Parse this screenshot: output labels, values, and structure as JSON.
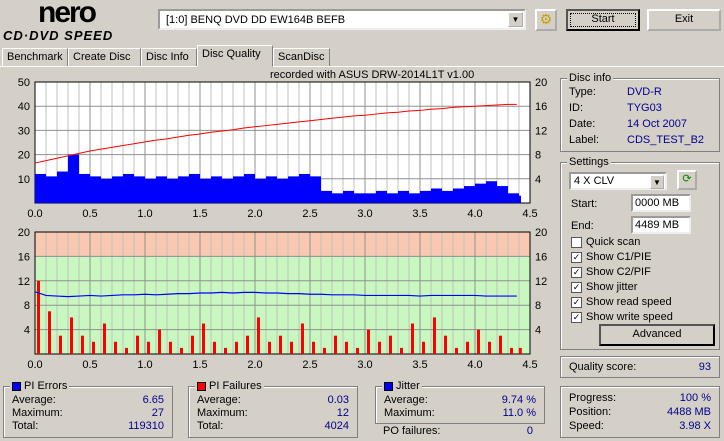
{
  "logo": {
    "top": "nero",
    "bottom": "CD·DVD SPEED"
  },
  "drive": "[1:0]  BENQ DVD DD EW164B BEFB",
  "buttons": {
    "start": "Start",
    "exit": "Exit",
    "advanced": "Advanced"
  },
  "tabs": [
    "Benchmark",
    "Create Disc",
    "Disc Info",
    "Disc Quality",
    "ScanDisc"
  ],
  "active_tab": "Disc Quality",
  "recorded_with": "recorded with ASUS    DRW-2014L1T      v1.00",
  "disc_info": {
    "title": "Disc info",
    "type_label": "Type:",
    "type": "DVD-R",
    "id_label": "ID:",
    "id": "TYG03",
    "date_label": "Date:",
    "date": "14 Oct 2007",
    "label_label": "Label:",
    "label": "CDS_TEST_B2"
  },
  "settings": {
    "title": "Settings",
    "speed": "4 X CLV",
    "start_label": "Start:",
    "start": "0000 MB",
    "end_label": "End:",
    "end": "4489 MB",
    "checks": [
      {
        "label": "Quick scan",
        "checked": false
      },
      {
        "label": "Show C1/PIE",
        "checked": true
      },
      {
        "label": "Show C2/PIF",
        "checked": true
      },
      {
        "label": "Show jitter",
        "checked": true
      },
      {
        "label": "Show read speed",
        "checked": true
      },
      {
        "label": "Show write speed",
        "checked": true
      }
    ]
  },
  "quality": {
    "label": "Quality score:",
    "value": "93"
  },
  "progress": {
    "progress_label": "Progress:",
    "progress": "100 %",
    "position_label": "Position:",
    "position": "4488 MB",
    "speed_label": "Speed:",
    "speed": "3.98 X"
  },
  "pi_errors": {
    "title": "PI Errors",
    "average_label": "Average:",
    "average": "6.65",
    "maximum_label": "Maximum:",
    "maximum": "27",
    "total_label": "Total:",
    "total": "119310"
  },
  "pi_failures": {
    "title": "PI Failures",
    "average_label": "Average:",
    "average": "0.03",
    "maximum_label": "Maximum:",
    "maximum": "12",
    "total_label": "Total:",
    "total": "4024"
  },
  "jitter": {
    "title": "Jitter",
    "average_label": "Average:",
    "average": "9.74 %",
    "maximum_label": "Maximum:",
    "maximum": "11.0 %",
    "po_label": "PO failures:",
    "po": "0"
  },
  "colors": {
    "pie": "#0000ff",
    "pif": "#ff0000",
    "jitter": "#0000ff",
    "speed": "#ff0000"
  },
  "chart_data": [
    {
      "type": "bar",
      "title": "PI errors / read speed",
      "x_ticks": [
        "0.0",
        "0.5",
        "1.0",
        "1.5",
        "2.0",
        "2.5",
        "3.0",
        "3.5",
        "4.0",
        "4.5"
      ],
      "xlim": [
        0,
        4.5
      ],
      "ylim": [
        0,
        50
      ],
      "y_ticks": [
        "10",
        "20",
        "30",
        "40",
        "50"
      ],
      "y2lim": [
        0,
        20
      ],
      "y2_ticks": [
        "4",
        "8",
        "12",
        "16",
        "20"
      ],
      "x": [
        0.0,
        0.1,
        0.2,
        0.3,
        0.4,
        0.5,
        0.6,
        0.7,
        0.8,
        0.9,
        1.0,
        1.1,
        1.2,
        1.3,
        1.4,
        1.5,
        1.6,
        1.7,
        1.8,
        1.9,
        2.0,
        2.1,
        2.2,
        2.3,
        2.4,
        2.5,
        2.6,
        2.7,
        2.8,
        2.9,
        3.0,
        3.1,
        3.2,
        3.3,
        3.4,
        3.5,
        3.6,
        3.7,
        3.8,
        3.9,
        4.0,
        4.1,
        4.2,
        4.3,
        4.38
      ],
      "pi_errors": [
        12,
        11,
        13,
        20,
        12,
        11,
        10,
        11,
        12,
        11,
        10,
        11,
        10,
        11,
        12,
        10,
        11,
        10,
        11,
        12,
        10,
        11,
        10,
        11,
        12,
        11,
        5,
        4,
        5,
        4,
        4,
        5,
        4,
        5,
        4,
        5,
        6,
        5,
        6,
        7,
        8,
        9,
        7,
        4,
        3
      ],
      "read_speed": [
        6.6,
        7.0,
        7.4,
        7.8,
        8.2,
        8.6,
        8.9,
        9.2,
        9.5,
        9.8,
        10.1,
        10.4,
        10.6,
        10.9,
        11.2,
        11.4,
        11.7,
        11.9,
        12.1,
        12.4,
        12.6,
        12.8,
        13.0,
        13.2,
        13.4,
        13.6,
        13.8,
        14.0,
        14.2,
        14.4,
        14.5,
        14.7,
        14.9,
        15.0,
        15.2,
        15.3,
        15.5,
        15.6,
        15.8,
        15.9,
        16.0,
        16.1,
        16.2,
        16.3,
        16.3
      ]
    },
    {
      "type": "bar",
      "title": "PI failures / jitter",
      "x_ticks": [
        "0.0",
        "0.5",
        "1.0",
        "1.5",
        "2.0",
        "2.5",
        "3.0",
        "3.5",
        "4.0",
        "4.5"
      ],
      "xlim": [
        0,
        4.5
      ],
      "ylim": [
        0,
        20
      ],
      "y_ticks": [
        "4",
        "8",
        "12",
        "16",
        "20"
      ],
      "y2_ticks": [
        "4",
        "8",
        "12",
        "16",
        "20"
      ],
      "x": [
        0.0,
        0.1,
        0.2,
        0.3,
        0.4,
        0.5,
        0.6,
        0.7,
        0.8,
        0.9,
        1.0,
        1.1,
        1.2,
        1.3,
        1.4,
        1.5,
        1.6,
        1.7,
        1.8,
        1.9,
        2.0,
        2.1,
        2.2,
        2.3,
        2.4,
        2.5,
        2.6,
        2.7,
        2.8,
        2.9,
        3.0,
        3.1,
        3.2,
        3.3,
        3.4,
        3.5,
        3.6,
        3.7,
        3.8,
        3.9,
        4.0,
        4.1,
        4.2,
        4.3,
        4.38
      ],
      "pi_failures": [
        12,
        7,
        3,
        6,
        3,
        2,
        5,
        2,
        1,
        3,
        2,
        4,
        2,
        1,
        3,
        5,
        2,
        1,
        2,
        3,
        6,
        2,
        3,
        2,
        5,
        2,
        1,
        3,
        2,
        1,
        4,
        2,
        3,
        1,
        5,
        2,
        6,
        3,
        1,
        2,
        4,
        2,
        3,
        1,
        1
      ],
      "jitter": [
        10.2,
        9.6,
        9.5,
        9.4,
        9.5,
        9.6,
        9.5,
        9.6,
        9.7,
        9.7,
        9.8,
        9.7,
        9.8,
        9.9,
        9.9,
        10.0,
        10.0,
        10.1,
        10.0,
        10.1,
        10.1,
        10.0,
        10.0,
        9.9,
        9.9,
        9.8,
        9.8,
        9.7,
        9.7,
        9.7,
        9.6,
        9.6,
        9.6,
        9.6,
        9.6,
        9.5,
        9.6,
        9.6,
        9.6,
        9.6,
        9.6,
        9.5,
        9.5,
        9.5,
        9.5
      ]
    }
  ]
}
